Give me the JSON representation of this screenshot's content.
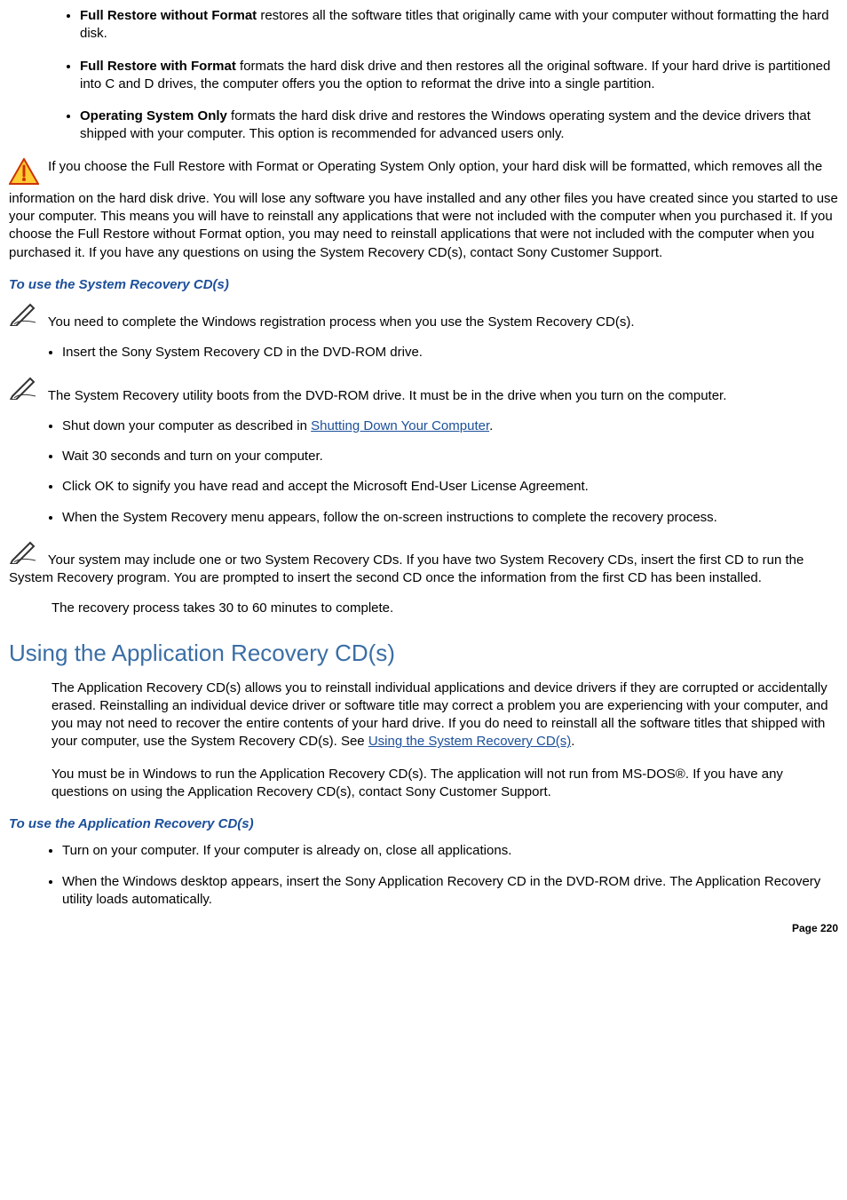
{
  "options": [
    {
      "title": "Full Restore without Format",
      "desc": " restores all the software titles that originally came with your computer without formatting the hard disk."
    },
    {
      "title": "Full Restore with Format",
      "desc": " formats the hard disk drive and then restores all the original software. If your hard drive is partitioned into C and D drives, the computer offers you the option to reformat the drive into a single partition."
    },
    {
      "title": "Operating System Only",
      "desc": " formats the hard disk drive and restores the Windows operating system and the device drivers that shipped with your computer. This option is recommended for advanced users only."
    }
  ],
  "warning1": " If you choose the Full Restore with Format or Operating System Only option, your hard disk will be formatted, which removes all the information on the hard disk drive. You will lose any software you have installed and any other files you have created since you started to use your computer. This means you will have to reinstall any applications that were not included with the computer when you purchased it. If you choose the Full Restore without Format option, you may need to reinstall applications that were not included with the computer when you purchased it. If you have any questions on using the System Recovery CD(s), contact Sony Customer Support.",
  "subheading1": "To use the System Recovery CD(s)",
  "note1": " You need to complete the Windows registration process when you use the System Recovery CD(s).",
  "step_insert": "Insert the Sony System Recovery CD in the DVD-ROM drive.",
  "note2": " The System Recovery utility boots from the DVD-ROM drive. It must be in the drive when you turn on the computer.",
  "steps2": {
    "shutdown_pre": "Shut down your computer as described in ",
    "shutdown_link": "Shutting Down Your Computer",
    "shutdown_post": ".",
    "wait": "Wait 30 seconds and turn on your computer.",
    "clickok": "Click OK to signify you have read and accept the Microsoft End-User License Agreement.",
    "menu": "When the System Recovery menu appears, follow the on-screen instructions to complete the recovery process."
  },
  "note3": " Your system may include one or two System Recovery CDs. If you have two System Recovery CDs, insert the first CD to run the System Recovery program. You are prompted to insert the second CD once the information from the first CD has been installed.",
  "note3b": "The recovery process takes 30 to 60 minutes to complete.",
  "heading2": "Using the Application Recovery CD(s)",
  "para2a_pre": "The Application Recovery CD(s) allows you to reinstall individual applications and device drivers if they are corrupted or accidentally erased. Reinstalling an individual device driver or software title may correct a problem you are experiencing with your computer, and you may not need to recover the entire contents of your hard drive. If you do need to reinstall all the software titles that shipped with your computer, use the System Recovery CD(s). See ",
  "para2a_link": "Using the System Recovery CD(s)",
  "para2a_post": ".",
  "para2b": "You must be in Windows to run the Application Recovery CD(s). The application will not run from MS-DOS®. If you have any questions on using the Application Recovery CD(s), contact Sony Customer Support.",
  "subheading2": "To use the Application Recovery CD(s)",
  "steps3": {
    "turnon": "Turn on your computer. If your computer is already on, close all applications.",
    "insert": "When the Windows desktop appears, insert the Sony Application Recovery CD in the DVD-ROM drive. The Application Recovery utility loads automatically."
  },
  "page": "Page 220"
}
